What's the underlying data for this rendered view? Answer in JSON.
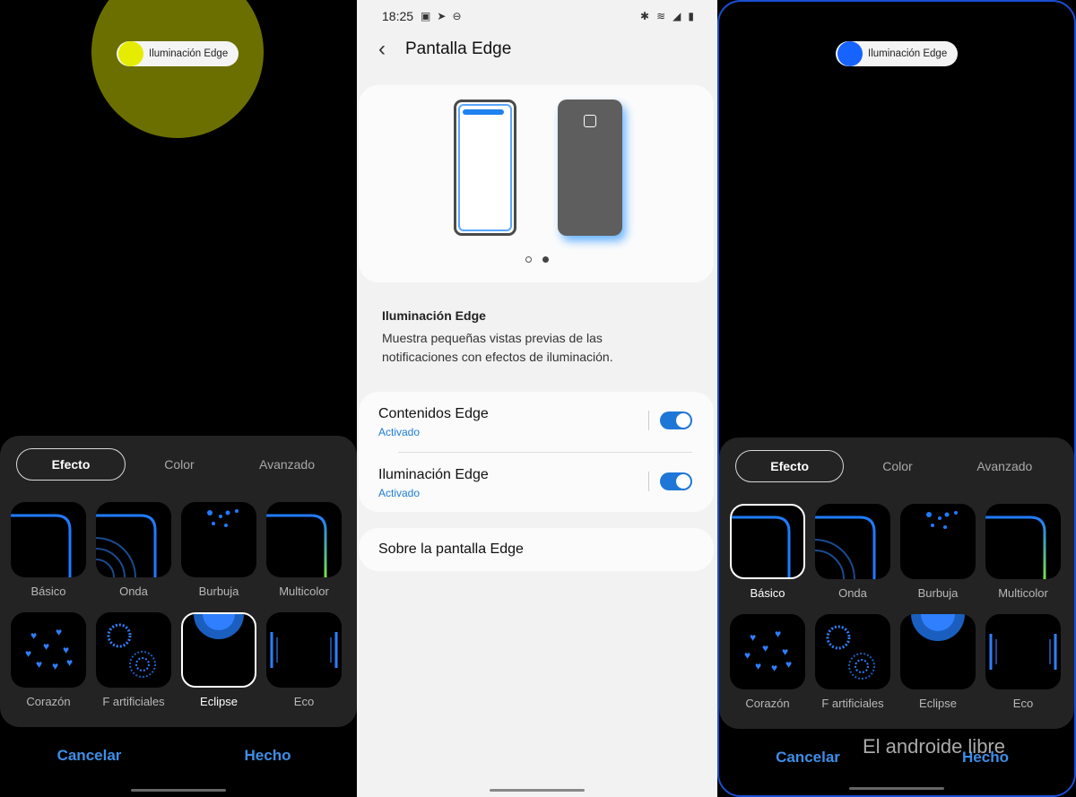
{
  "left": {
    "notification": "Iluminación Edge",
    "tabs": [
      "Efecto",
      "Color",
      "Avanzado"
    ],
    "effects": [
      {
        "label": "Básico",
        "icon": "basic-effect-icon"
      },
      {
        "label": "Onda",
        "icon": "wave-effect-icon"
      },
      {
        "label": "Burbuja",
        "icon": "bubble-effect-icon"
      },
      {
        "label": "Multicolor",
        "icon": "multicolor-effect-icon"
      },
      {
        "label": "Corazón",
        "icon": "heart-effect-icon"
      },
      {
        "label": "F artificiales",
        "icon": "fireworks-effect-icon"
      },
      {
        "label": "Eclipse",
        "icon": "eclipse-effect-icon"
      },
      {
        "label": "Eco",
        "icon": "echo-effect-icon"
      }
    ],
    "selected": "Eclipse",
    "cancel": "Cancelar",
    "done": "Hecho",
    "accent": "#e6ec00"
  },
  "middle": {
    "status": {
      "time": "18:25"
    },
    "title": "Pantalla Edge",
    "section_title": "Iluminación Edge",
    "section_desc": "Muestra pequeñas vistas previas de las notificaciones con efectos de iluminación.",
    "rows": [
      {
        "label": "Contenidos Edge",
        "sub": "Activado"
      },
      {
        "label": "Iluminación Edge",
        "sub": "Activado"
      }
    ],
    "about": "Sobre la pantalla Edge"
  },
  "right": {
    "notification": "Iluminación Edge",
    "tabs": [
      "Efecto",
      "Color",
      "Avanzado"
    ],
    "effects": [
      {
        "label": "Básico"
      },
      {
        "label": "Onda"
      },
      {
        "label": "Burbuja"
      },
      {
        "label": "Multicolor"
      },
      {
        "label": "Corazón"
      },
      {
        "label": "F artificiales"
      },
      {
        "label": "Eclipse"
      },
      {
        "label": "Eco"
      }
    ],
    "selected": "Básico",
    "cancel": "Cancelar",
    "done": "Hecho",
    "watermark": "El androide libre",
    "accent": "#1663ff"
  }
}
